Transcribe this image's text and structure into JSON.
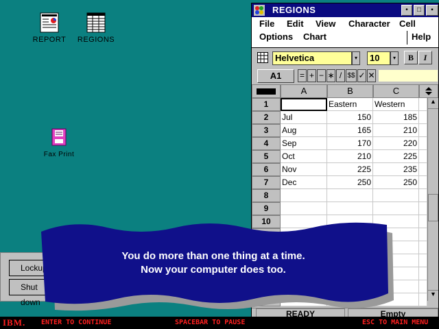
{
  "desktop": {
    "icons": [
      {
        "label": "REPORT",
        "icon": "report-icon"
      },
      {
        "label": "REGIONS",
        "icon": "spreadsheet-icon"
      },
      {
        "label": "Fax Print",
        "icon": "fax-print-icon"
      }
    ]
  },
  "window": {
    "title": "REGIONS",
    "menus": [
      "File",
      "Edit",
      "View",
      "Character",
      "Cell",
      "Options",
      "Chart",
      "Help"
    ],
    "font_name": "Helvetica",
    "font_size": "10",
    "bold_label": "B",
    "italic_label": "I",
    "cell_ref": "A1",
    "operators": [
      "=",
      "+",
      "−",
      "∗",
      "/",
      "$$",
      "✓",
      "✕"
    ],
    "columns": [
      "A",
      "B",
      "C"
    ],
    "row_numbers": [
      "1",
      "2",
      "3",
      "4",
      "5",
      "6",
      "7",
      "8",
      "9",
      "10"
    ],
    "rows": [
      [
        "",
        "Eastern",
        "Western"
      ],
      [
        "Jul",
        "150",
        "185"
      ],
      [
        "Aug",
        "165",
        "210"
      ],
      [
        "Sep",
        "170",
        "220"
      ],
      [
        "Oct",
        "210",
        "225"
      ],
      [
        "Nov",
        "225",
        "235"
      ],
      [
        "Dec",
        "250",
        "250"
      ]
    ],
    "status_left": "READY",
    "status_right": "Empty"
  },
  "dialog": {
    "buttons": [
      "Lockup",
      "Shut down"
    ]
  },
  "banner": {
    "line1": "You do more than one thing at a time.",
    "line2": "Now your computer does too."
  },
  "bottom_bar": {
    "logo": "IBM.",
    "continue": "ENTER TO CONTINUE",
    "pause": "SPACEBAR TO PAUSE",
    "menu": "ESC TO MAIN MENU"
  },
  "colors": {
    "desktop": "#0b8080",
    "title_bar": "#0a0a80",
    "banner": "#10108a",
    "bottom_bar_text": "#ff2020",
    "field": "#ffff99"
  }
}
